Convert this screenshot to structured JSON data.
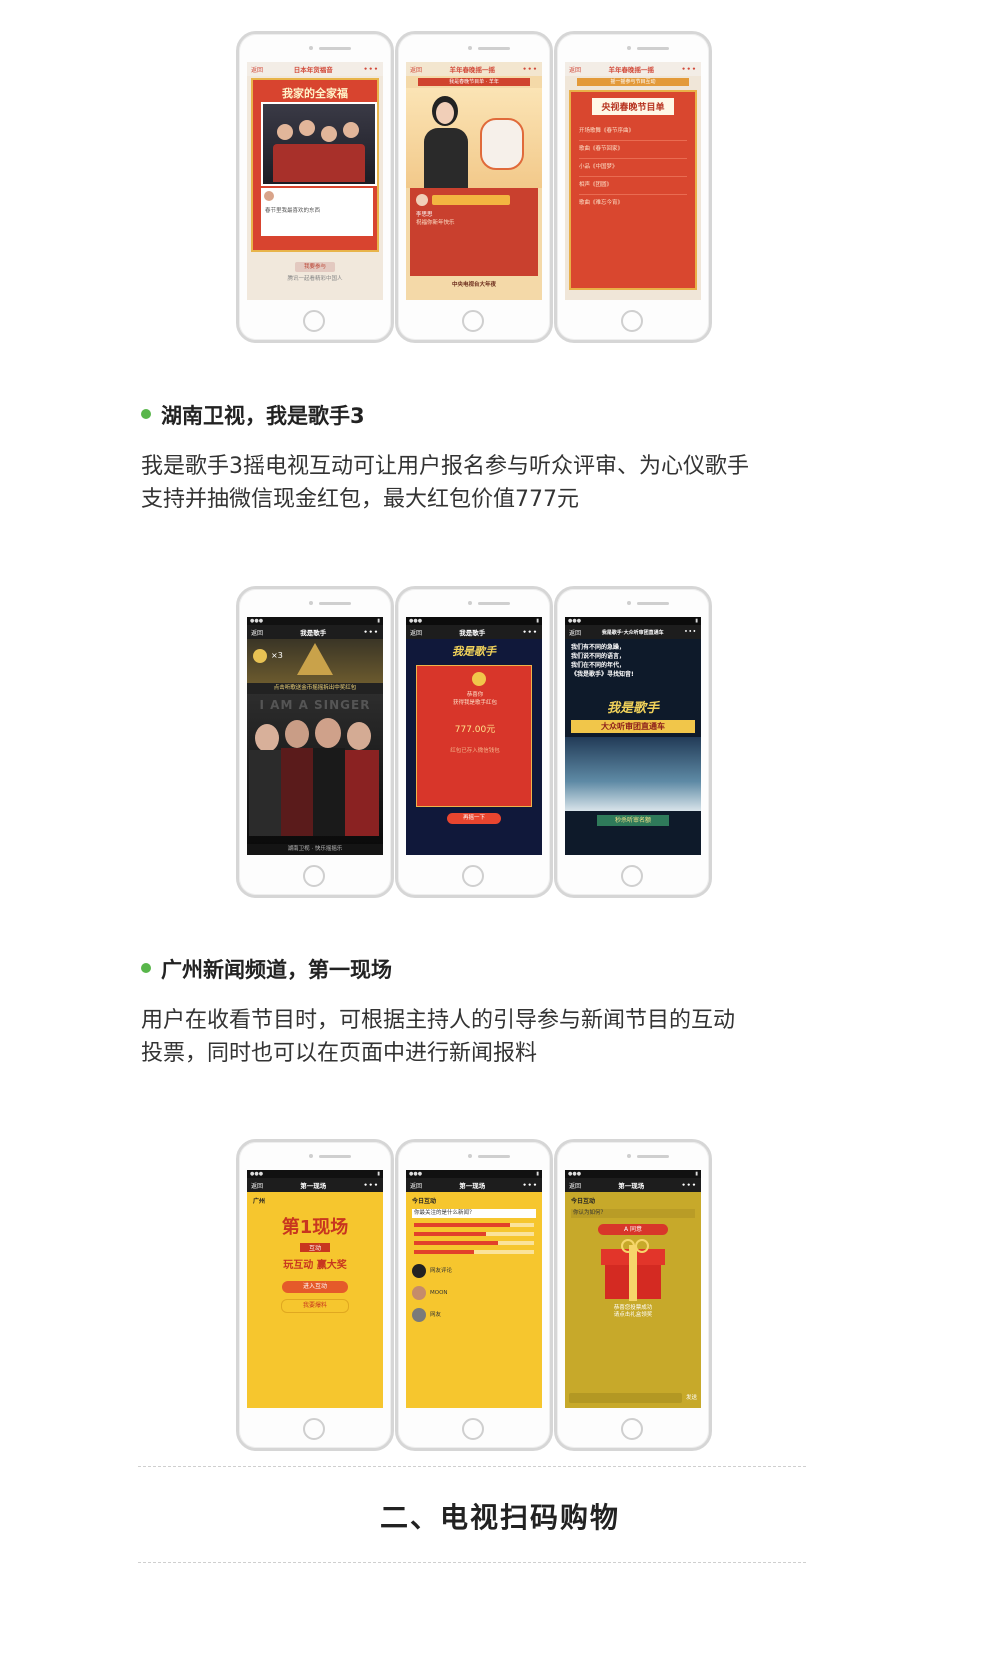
{
  "group1": {
    "phone1": {
      "back": "返回",
      "nav_title": "日本年货福音",
      "more": "•••",
      "banner": "我家的全家福",
      "caption": "春节里我最喜欢的东西",
      "button": "我要参与",
      "footer": "腾讯一起看精彩中国人"
    },
    "phone2": {
      "back": "返回",
      "nav_title": "羊年春晚摇一摇",
      "more": "•••",
      "top_bar": "我是春晚节目单 · 羊年",
      "name": "李思思",
      "msg": "祝福你新年快乐",
      "footer": "中央电视台大年夜"
    },
    "phone3": {
      "back": "返回",
      "nav_title": "羊年春晚摇一摇",
      "more": "•••",
      "top_bar": "摇一摇参与节目互动",
      "card_title": "央视春晚节目单",
      "items": [
        "开场歌舞《春节序曲》",
        "歌曲《春节回家》",
        "小品《中国梦》",
        "相声《团圆》",
        "歌曲《难忘今宵》"
      ]
    }
  },
  "section1": {
    "heading": "湖南卫视，我是歌手3",
    "para_line1": "我是歌手3摇电视互动可让用户报名参与听众评审、为心仪歌手",
    "para_line2": "支持并抽微信现金红包，最大红包价值777元"
  },
  "group2": {
    "phone1": {
      "back": "返回",
      "nav_title": "我是歌手",
      "more": "•••",
      "count": "×3",
      "blurb": "点击听歌送金币摇摇拆出中奖红包",
      "wall": "I AM A SINGER",
      "footer": "湖南卫视 · 快乐摇摇乐"
    },
    "phone2": {
      "back": "返回",
      "nav_title": "我是歌手",
      "more": "•••",
      "logo": "我是歌手",
      "envelope_line1": "恭喜你",
      "envelope_line2": "获得我是歌手红包",
      "amount": "777.00元",
      "note": "红包已存入微信钱包",
      "button": "再摇一下"
    },
    "phone3": {
      "back": "返回",
      "nav_title": "我是歌手·大众听审团直通车",
      "more": "•••",
      "lines": [
        "我们有不同的急躁，",
        "我们说不同的语言，",
        "我们在不同的年代，",
        "《我是歌手》寻找知音!"
      ],
      "logo": "我是歌手",
      "banner": "大众听审团直通车",
      "button": "秒杀听审名额"
    }
  },
  "section2": {
    "heading": "广州新闻频道，第一现场",
    "para_line1": "用户在收看节目时，可根据主持人的引导参与新闻节目的互动",
    "para_line2": "投票，同时也可以在页面中进行新闻报料"
  },
  "group3": {
    "phone1": {
      "back": "返回",
      "nav_title": "第一现场",
      "more": "•••",
      "logo": "广州",
      "big": "第1现场",
      "badge": "互动",
      "slogan": "玩互动 赢大奖",
      "button1": "进入互动",
      "button2": "我要爆料"
    },
    "phone2": {
      "back": "返回",
      "nav_title": "第一现场",
      "more": "•••",
      "logo": "今日互动",
      "question": "你最关注的是什么新闻？",
      "bars": [
        0.8,
        0.6,
        0.7,
        0.5
      ],
      "comment1": "网友评论",
      "comment2": "MOON",
      "comment3": "网友"
    },
    "phone3": {
      "back": "返回",
      "nav_title": "第一现场",
      "more": "•••",
      "logo": "今日互动",
      "question": "你认为如何？",
      "option": "A 同意",
      "result_line1": "恭喜您投票成功",
      "result_line2": "请点击礼盒领奖",
      "send": "发送"
    }
  },
  "section3": {
    "title": "二、电视扫码购物"
  }
}
